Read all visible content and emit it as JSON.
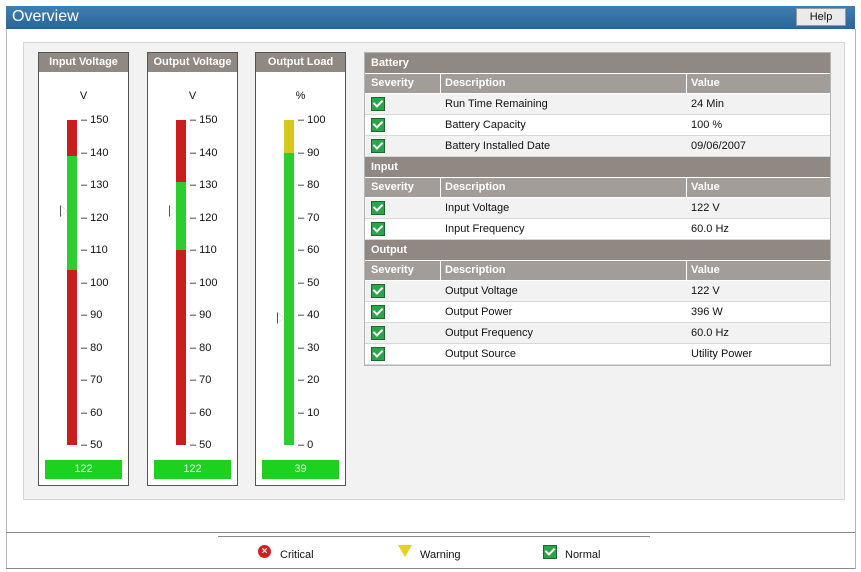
{
  "window": {
    "title": "Overview",
    "help_label": "Help"
  },
  "gauges": [
    {
      "title": "Input Voltage",
      "unit": "V",
      "ticks": [
        "150",
        "140",
        "130",
        "120",
        "110",
        "100",
        "90",
        "80",
        "70",
        "60",
        "50"
      ],
      "value_label": "122"
    },
    {
      "title": "Output Voltage",
      "unit": "V",
      "ticks": [
        "150",
        "140",
        "130",
        "120",
        "110",
        "100",
        "90",
        "80",
        "70",
        "60",
        "50"
      ],
      "value_label": "122"
    },
    {
      "title": "Output Load",
      "unit": "%",
      "ticks": [
        "100",
        "90",
        "80",
        "70",
        "60",
        "50",
        "40",
        "30",
        "20",
        "10",
        "0"
      ],
      "value_label": "39"
    }
  ],
  "gauge_levels": {
    "input_voltage": {
      "min": 50,
      "max": 150,
      "value": 122,
      "green_range": [
        104,
        139
      ]
    },
    "output_voltage": {
      "min": 50,
      "max": 150,
      "value": 122,
      "green_range": [
        110,
        131
      ]
    },
    "output_load": {
      "min": 0,
      "max": 100,
      "value": 39,
      "yellow_range": [
        90,
        100
      ]
    }
  },
  "colors": {
    "critical": "#c81e1e",
    "normal": "#2ecc2e",
    "warning": "#d8c81e",
    "header": "#8f8883",
    "titlebar": "#2c6496"
  },
  "status_table": {
    "headers": {
      "severity": "Severity",
      "description": "Description",
      "value": "Value"
    },
    "sections": [
      {
        "name": "Battery",
        "rows": [
          {
            "severity": "normal",
            "description": "Run Time Remaining",
            "value": "24 Min"
          },
          {
            "severity": "normal",
            "description": "Battery Capacity",
            "value": "100 %"
          },
          {
            "severity": "normal",
            "description": "Battery Installed Date",
            "value": "09/06/2007"
          }
        ]
      },
      {
        "name": "Input",
        "rows": [
          {
            "severity": "normal",
            "description": "Input Voltage",
            "value": "122 V"
          },
          {
            "severity": "normal",
            "description": "Input Frequency",
            "value": "60.0 Hz"
          }
        ]
      },
      {
        "name": "Output",
        "rows": [
          {
            "severity": "normal",
            "description": "Output Voltage",
            "value": "122 V"
          },
          {
            "severity": "normal",
            "description": "Output Power",
            "value": "396 W"
          },
          {
            "severity": "normal",
            "description": "Output Frequency",
            "value": "60.0 Hz"
          },
          {
            "severity": "normal",
            "description": "Output Source",
            "value": "Utility Power"
          }
        ]
      }
    ]
  },
  "legend": {
    "critical": "Critical",
    "warning": "Warning",
    "normal": "Normal"
  }
}
